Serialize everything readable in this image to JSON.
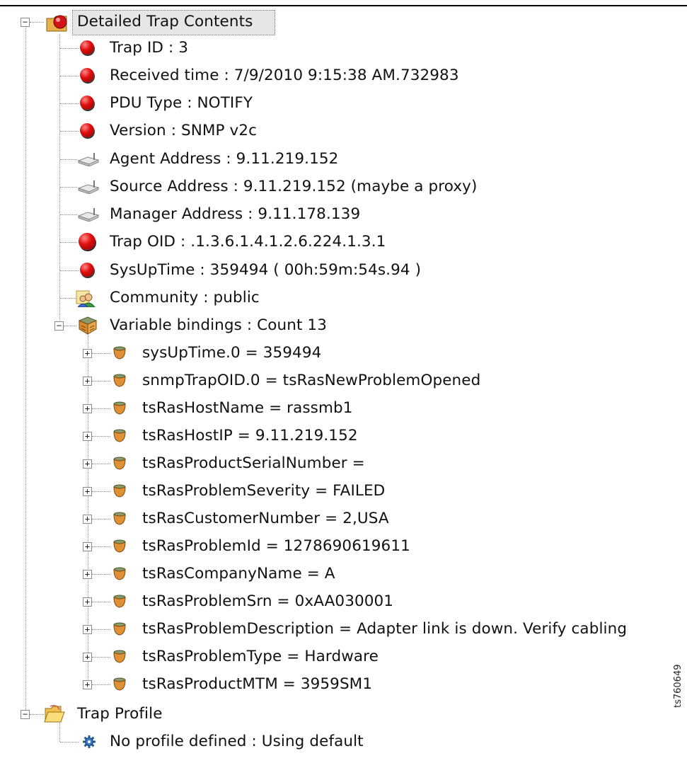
{
  "root": {
    "label": "Detailed Trap Contents",
    "fields": [
      {
        "label": "Trap ID : 3",
        "icon": "red-ball-icon"
      },
      {
        "label": "Received time : 7/9/2010 9:15:38 AM.732983",
        "icon": "red-ball-icon"
      },
      {
        "label": "PDU Type : NOTIFY",
        "icon": "red-ball-icon"
      },
      {
        "label": "Version : SNMP v2c",
        "icon": "red-ball-icon"
      },
      {
        "label": "Agent Address : 9.11.219.152",
        "icon": "network-device-icon"
      },
      {
        "label": "Source Address : 9.11.219.152 (maybe a proxy)",
        "icon": "network-device-icon"
      },
      {
        "label": "Manager Address : 9.11.178.139",
        "icon": "network-device-icon"
      },
      {
        "label": "Trap OID : .1.3.6.1.4.1.2.6.224.1.3.1",
        "icon": "red-ball-icon"
      },
      {
        "label": "SysUpTime : 359494  ( 00h:59m:54s.94 )",
        "icon": "red-ball-icon"
      },
      {
        "label": "Community : public",
        "icon": "community-icon"
      }
    ],
    "bindings": {
      "label": "Variable bindings : Count 13",
      "items": [
        "sysUpTime.0 = 359494",
        "snmpTrapOID.0 = tsRasNewProblemOpened",
        "tsRasHostName = rassmb1",
        "tsRasHostIP = 9.11.219.152",
        "tsRasProductSerialNumber =",
        "tsRasProblemSeverity = FAILED",
        "tsRasCustomerNumber = 2,USA",
        "tsRasProblemId = 1278690619611",
        "tsRasCompanyName = A",
        "tsRasProblemSrn = 0xAA030001",
        "tsRasProblemDescription = Adapter link is down. Verify cabling",
        "tsRasProblemType = Hardware",
        "tsRasProductMTM = 3959SM1"
      ]
    }
  },
  "profile": {
    "label": "Trap Profile",
    "items": [
      "No profile defined : Using default"
    ]
  },
  "figure_id": "ts760649",
  "colors": {
    "selection": "#e6e6e6",
    "connector": "#8a8a8a",
    "accent_red": "#e01010"
  }
}
